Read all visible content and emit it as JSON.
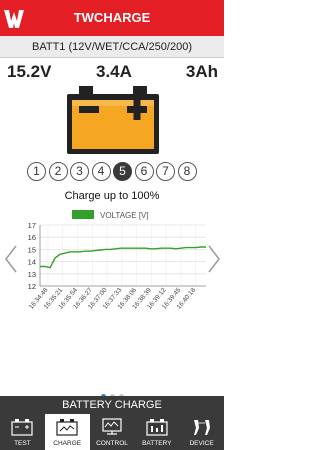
{
  "app": {
    "title": "TWCHARGE"
  },
  "battery": {
    "label": "BATT1 (12V/WET/CCA/250/200)"
  },
  "metrics": {
    "voltage": "15.2V",
    "current": "3.4A",
    "capacity": "3Ah"
  },
  "steps": {
    "items": [
      "1",
      "2",
      "3",
      "4",
      "5",
      "6",
      "7",
      "8"
    ],
    "active_index": 4
  },
  "stage_text": "Charge up to 100%",
  "section_title": "BATTERY CHARGE",
  "pager": {
    "pages": 3,
    "active_index": 0
  },
  "tabs": [
    {
      "label": "TEST",
      "icon": "battery-test-icon",
      "active": false
    },
    {
      "label": "CHARGE",
      "icon": "battery-charge-icon",
      "active": true
    },
    {
      "label": "CONTROL",
      "icon": "control-monitor-icon",
      "active": false
    },
    {
      "label": "BATTERY",
      "icon": "battery-settings-icon",
      "active": false
    },
    {
      "label": "DEVICE",
      "icon": "device-clamps-icon",
      "active": false
    }
  ],
  "colors": {
    "brand_red": "#e31e24",
    "battery_fill": "#f5a623",
    "chart_line": "#33a02c",
    "dark_bar": "#3a3a3a",
    "pager_active": "#2f7fd6"
  },
  "chart_data": {
    "type": "line",
    "legend": "VOLTAGE [V]",
    "ylim": [
      12,
      17
    ],
    "yticks": [
      12,
      13,
      14,
      15,
      16,
      17
    ],
    "grid": true,
    "x": [
      "16:34:48",
      "16:35:21",
      "16:35:54",
      "16:36:27",
      "16:37:00",
      "16:37:33",
      "16:38:06",
      "16:38:39",
      "16:39:12",
      "16:39:45",
      "16:40:18"
    ],
    "series": [
      {
        "name": "VOLTAGE [V]",
        "values": [
          13.6,
          13.6,
          13.5,
          14.3,
          14.6,
          14.7,
          14.8,
          14.8,
          14.8,
          14.85,
          14.85,
          14.9,
          14.95,
          15.0,
          15.0,
          15.05,
          15.1,
          15.1,
          15.1,
          15.1,
          15.1,
          15.1,
          15.05,
          15.05,
          15.1,
          15.1,
          15.1,
          15.05,
          15.1,
          15.15,
          15.15,
          15.15,
          15.2,
          15.2
        ]
      }
    ]
  }
}
